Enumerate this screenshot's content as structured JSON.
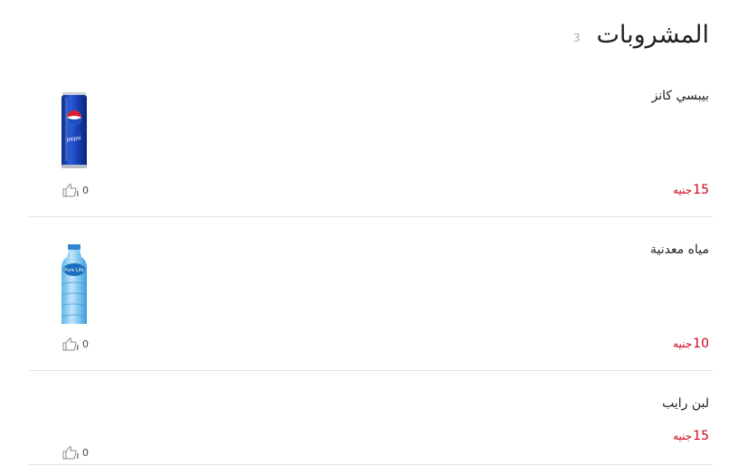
{
  "section": {
    "title": "المشروبات",
    "count": "3"
  },
  "items": [
    {
      "name": "بيبسي كانز",
      "price": "15",
      "currency": "جنيه",
      "likes": "0",
      "image": "pepsi-can"
    },
    {
      "name": "مياه معدنية",
      "price": "10",
      "currency": "جنيه",
      "likes": "0",
      "image": "water-bottle"
    },
    {
      "name": "لبن رايب",
      "price": "15",
      "currency": "جنيه",
      "likes": "0",
      "image": ""
    }
  ],
  "colors": {
    "price": "#d0021b",
    "divider": "#e5e5e5",
    "count": "#aaaaaa"
  }
}
